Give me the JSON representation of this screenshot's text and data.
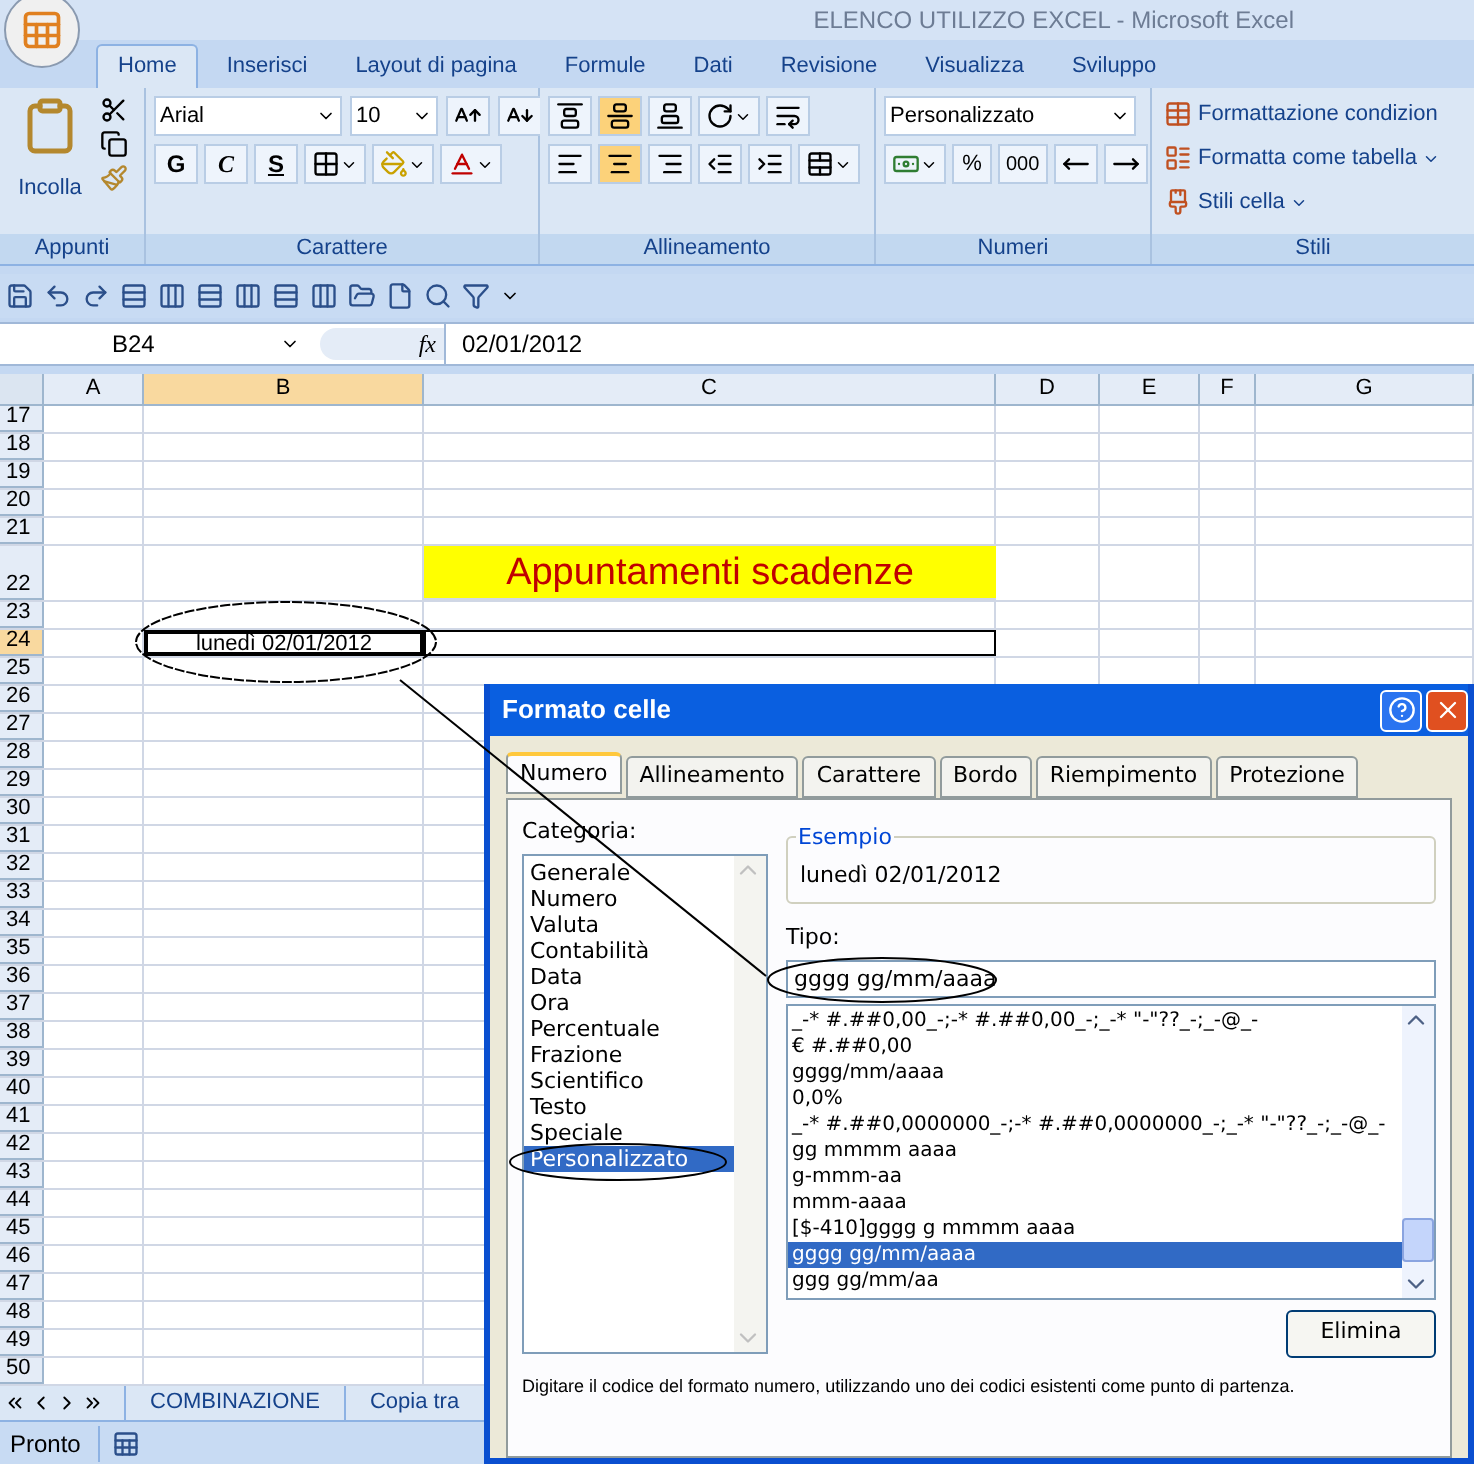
{
  "window": {
    "title": "ELENCO UTILIZZO EXCEL - Microsoft Excel"
  },
  "ribbon_tabs": [
    {
      "label": "Home",
      "selected": true
    },
    {
      "label": "Inserisci",
      "selected": false
    },
    {
      "label": "Layout di pagina",
      "selected": false
    },
    {
      "label": "Formule",
      "selected": false
    },
    {
      "label": "Dati",
      "selected": false
    },
    {
      "label": "Revisione",
      "selected": false
    },
    {
      "label": "Visualizza",
      "selected": false
    },
    {
      "label": "Sviluppo",
      "selected": false
    }
  ],
  "ribbon": {
    "paste": "Incolla",
    "font": "Arial",
    "font_size": "10",
    "bold": "G",
    "italic": "C",
    "underline": "S",
    "vertical_align": [
      {
        "selected": false
      },
      {
        "selected": true
      },
      {
        "selected": false
      }
    ],
    "horizontal_align": [
      {
        "selected": false
      },
      {
        "selected": true
      },
      {
        "selected": false
      }
    ],
    "number_format": "Personalizzato",
    "percent": "%",
    "thousands": "000",
    "styles": [
      "Formattazione condizion",
      "Formatta come tabella",
      "Stili cella"
    ],
    "groups": [
      "Appunti",
      "Carattere",
      "Allineamento",
      "Numeri",
      "Stili"
    ]
  },
  "formula_bar": {
    "name_box": "B24",
    "fx": "fx",
    "value": "02/01/2012"
  },
  "columns": [
    {
      "label": "A",
      "selected": false
    },
    {
      "label": "B",
      "selected": true
    },
    {
      "label": "C",
      "selected": false
    },
    {
      "label": "D",
      "selected": false
    },
    {
      "label": "E",
      "selected": false
    },
    {
      "label": "F",
      "selected": false
    },
    {
      "label": "G",
      "selected": false
    }
  ],
  "rows": [
    {
      "label": "17",
      "selected": false
    },
    {
      "label": "18",
      "selected": false
    },
    {
      "label": "19",
      "selected": false
    },
    {
      "label": "20",
      "selected": false
    },
    {
      "label": "21",
      "selected": false
    },
    {
      "label": "22",
      "selected": false
    },
    {
      "label": "23",
      "selected": false
    },
    {
      "label": "24",
      "selected": true
    },
    {
      "label": "25",
      "selected": false
    },
    {
      "label": "26",
      "selected": false
    },
    {
      "label": "27",
      "selected": false
    },
    {
      "label": "28",
      "selected": false
    },
    {
      "label": "29",
      "selected": false
    },
    {
      "label": "30",
      "selected": false
    },
    {
      "label": "31",
      "selected": false
    },
    {
      "label": "32",
      "selected": false
    },
    {
      "label": "33",
      "selected": false
    },
    {
      "label": "34",
      "selected": false
    },
    {
      "label": "35",
      "selected": false
    },
    {
      "label": "36",
      "selected": false
    },
    {
      "label": "37",
      "selected": false
    },
    {
      "label": "38",
      "selected": false
    },
    {
      "label": "39",
      "selected": false
    },
    {
      "label": "40",
      "selected": false
    },
    {
      "label": "41",
      "selected": false
    },
    {
      "label": "42",
      "selected": false
    },
    {
      "label": "43",
      "selected": false
    },
    {
      "label": "44",
      "selected": false
    },
    {
      "label": "45",
      "selected": false
    },
    {
      "label": "46",
      "selected": false
    },
    {
      "label": "47",
      "selected": false
    },
    {
      "label": "48",
      "selected": false
    },
    {
      "label": "49",
      "selected": false
    },
    {
      "label": "50",
      "selected": false
    }
  ],
  "sheet": {
    "title_cell": "Appuntamenti scadenze",
    "active_cell": "lunedì 02/01/2012"
  },
  "sheet_tabs": [
    {
      "label": "COMBINAZIONE",
      "selected": false
    },
    {
      "label": "Copia tra",
      "selected": false
    }
  ],
  "status_bar": {
    "text": "Pronto"
  },
  "dialog": {
    "title": "Formato celle",
    "tabs": [
      {
        "label": "Numero",
        "selected": true
      },
      {
        "label": "Allineamento",
        "selected": false
      },
      {
        "label": "Carattere",
        "selected": false
      },
      {
        "label": "Bordo",
        "selected": false
      },
      {
        "label": "Riempimento",
        "selected": false
      },
      {
        "label": "Protezione",
        "selected": false
      }
    ],
    "category_label": "Categoria:",
    "categories": [
      {
        "label": "Generale",
        "selected": false
      },
      {
        "label": "Numero",
        "selected": false
      },
      {
        "label": "Valuta",
        "selected": false
      },
      {
        "label": "Contabilità",
        "selected": false
      },
      {
        "label": "Data",
        "selected": false
      },
      {
        "label": "Ora",
        "selected": false
      },
      {
        "label": "Percentuale",
        "selected": false
      },
      {
        "label": "Frazione",
        "selected": false
      },
      {
        "label": "Scientifico",
        "selected": false
      },
      {
        "label": "Testo",
        "selected": false
      },
      {
        "label": "Speciale",
        "selected": false
      },
      {
        "label": "Personalizzato",
        "selected": true
      }
    ],
    "sample_label": "Esempio",
    "sample": "lunedì 02/01/2012",
    "type_label": "Tipo:",
    "type_value": "gggg gg/mm/aaaa",
    "formats": [
      {
        "label": "_-* #.##0,00_-;-* #.##0,00_-;_-* \"-\"??_-;_-@_-",
        "selected": false
      },
      {
        "label": "€ #.##0,00",
        "selected": false
      },
      {
        "label": "gggg/mm/aaaa",
        "selected": false
      },
      {
        "label": "0,0%",
        "selected": false
      },
      {
        "label": "_-* #.##0,0000000_-;-* #.##0,0000000_-;_-* \"-\"??_-;_-@_-",
        "selected": false
      },
      {
        "label": "gg mmmm aaaa",
        "selected": false
      },
      {
        "label": "g-mmm-aa",
        "selected": false
      },
      {
        "label": "mmm-aaaa",
        "selected": false
      },
      {
        "label": "[$-410]gggg g mmmm aaaa",
        "selected": false
      },
      {
        "label": "gggg gg/mm/aaaa",
        "selected": true
      },
      {
        "label": "ggg gg/mm/aa",
        "selected": false
      }
    ],
    "delete_button": "Elimina",
    "hint": "Digitare il codice del formato numero, utilizzando uno dei codici esistenti come punto di partenza."
  }
}
